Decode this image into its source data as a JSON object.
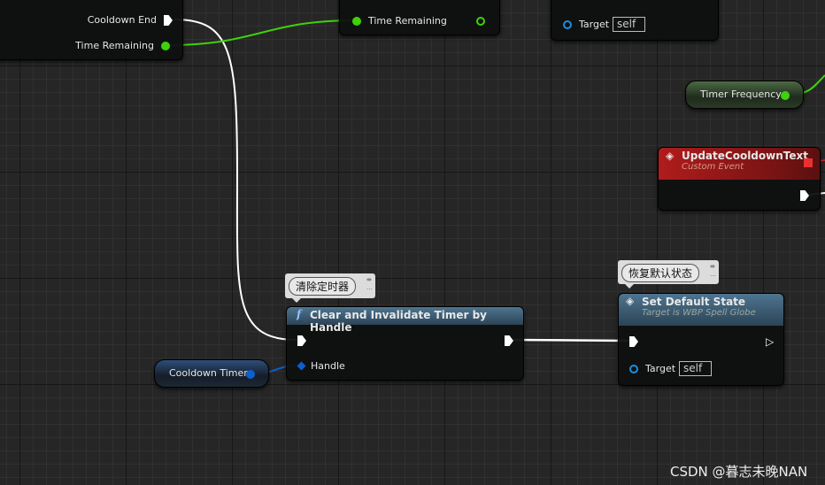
{
  "nodes": {
    "top_left": {
      "pins": {
        "cooldown_end": "Cooldown End",
        "time_remaining": "Time Remaining"
      }
    },
    "top_middle": {
      "pins": {
        "time_remaining": "Time Remaining"
      }
    },
    "top_right": {
      "target_label": "Target",
      "target_value": "self"
    },
    "timer_frequency": {
      "label": "Timer Frequency"
    },
    "update_cooldown_text": {
      "title": "UpdateCooldownText",
      "subtitle": "Custom Event"
    },
    "clear_timer": {
      "comment": "清除定时器",
      "title": "Clear and Invalidate Timer by Handle",
      "handle_label": "Handle",
      "icon": "f"
    },
    "cooldown_timer": {
      "label": "Cooldown Timer"
    },
    "set_default_state": {
      "comment": "恢复默认状态",
      "title": "Set Default State",
      "subtitle": "Target is WBP Spell Globe",
      "target_label": "Target",
      "target_value": "self"
    }
  },
  "colors": {
    "exec": "#ffffff",
    "float": "#3fd10a",
    "object": "#1a8fe0",
    "struct": "#0d5fd0",
    "event_header": "#8e1a1a",
    "function_header": "#3a5a73"
  },
  "watermark": "CSDN @暮志未晚NAN"
}
